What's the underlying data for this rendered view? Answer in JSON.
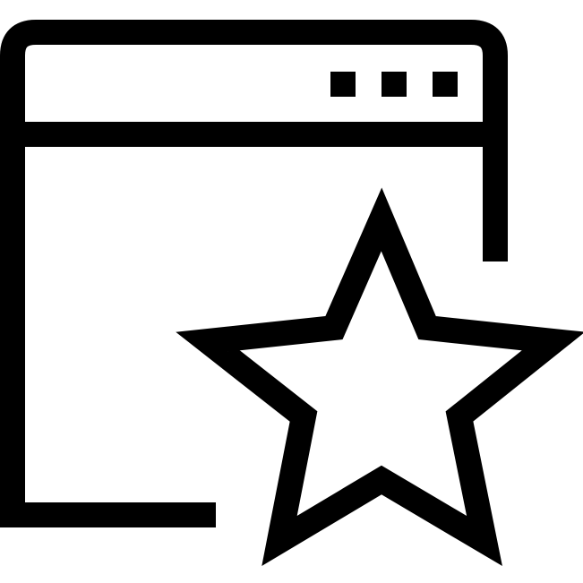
{
  "icon": {
    "name": "browser-window-favorite-icon",
    "parts": [
      "browser-window-icon",
      "window-dots-icon",
      "star-icon"
    ],
    "stroke_color": "#000000",
    "background_color": "#ffffff",
    "window_control_dots": 3
  }
}
